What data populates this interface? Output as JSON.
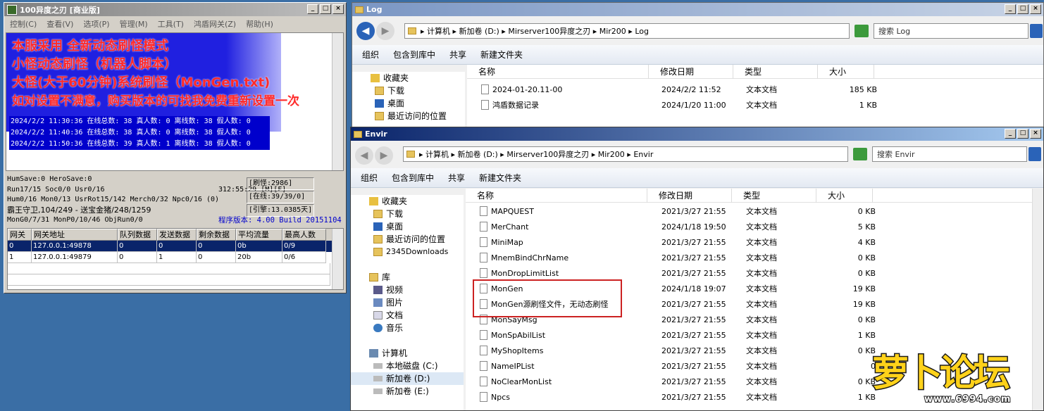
{
  "left_window": {
    "title": "100异度之刃 [商业版]",
    "menu": [
      "控制(C)",
      "查看(V)",
      "选项(P)",
      "管理(M)",
      "工具(T)",
      "鸿盾网关(Z)",
      "帮助(H)"
    ],
    "overlay_lines": [
      "本服采用 全新动态刷怪模式",
      "小怪动态刷怪（机器人脚本）",
      "大怪(大于60分钟)系统刷怪（MonGen.txt)",
      "如对设置不满意，购买版本的可找我免费重新设置一次"
    ],
    "log_lines": [
      "2024/2/2 11:30:36 在线总数: 38 真人数: 0 离线数: 38 假人数: 0",
      "2024/2/2 11:40:36 在线总数: 38 真人数: 0 离线数: 38 假人数: 0",
      "2024/2/2 11:50:36 在线总数: 39 真人数: 1 离线数: 38 假人数: 0"
    ],
    "status": {
      "hum_save": "HumSave:0 HeroSave:0",
      "run": "Run17/15 Soc0/0 Usr0/16",
      "time": "312:55:29 [M][F]",
      "hum": "Hum0/16 Mon0/13 UsrRot15/142 Merch0/32 Npc0/16 (0)",
      "king": "霸王守卫,104/249 - 送宝金猪/248/1259",
      "mongen": "MonG0/7/31 MonP0/10/46 ObjRun0/0",
      "refresh": "[刷怪:2986]",
      "online": "[在线:39/39/0]",
      "engine": "[引擎:13.0385天]",
      "version": "程序版本: 4.00 Build 20151104"
    },
    "grid": {
      "headers": [
        "网关",
        "网关地址",
        "队列数据",
        "发送数据",
        "剩余数据",
        "平均流量",
        "最高人数"
      ],
      "rows": [
        [
          "0",
          "127.0.0.1:49878",
          "0",
          "0",
          "0",
          "0b",
          "0/9"
        ],
        [
          "1",
          "127.0.0.1:49879",
          "0",
          "1",
          "0",
          "20b",
          "0/6"
        ]
      ]
    }
  },
  "log_window": {
    "title": "Log",
    "path": [
      "计算机",
      "新加卷 (D:)",
      "Mirserver100异度之刃",
      "Mir200",
      "Log"
    ],
    "search_placeholder": "搜索 Log",
    "toolbar": [
      "组织",
      "包含到库中",
      "共享",
      "新建文件夹"
    ],
    "nav": [
      "收藏夹",
      "下载",
      "桌面",
      "最近访问的位置"
    ],
    "columns": [
      "名称",
      "修改日期",
      "类型",
      "大小"
    ],
    "files": [
      {
        "name": "2024-01-20.11-00",
        "date": "2024/2/2 11:52",
        "type": "文本文档",
        "size": "185 KB"
      },
      {
        "name": "鸿盾数据记录",
        "date": "2024/1/20 11:00",
        "type": "文本文档",
        "size": "1 KB"
      }
    ]
  },
  "envir_window": {
    "title": "Envir",
    "path": [
      "计算机",
      "新加卷 (D:)",
      "Mirserver100异度之刃",
      "Mir200",
      "Envir"
    ],
    "search_placeholder": "搜索 Envir",
    "toolbar": [
      "组织",
      "包含到库中",
      "共享",
      "新建文件夹"
    ],
    "nav": {
      "favorites": [
        "收藏夹",
        "下载",
        "桌面",
        "最近访问的位置",
        "2345Downloads"
      ],
      "library": [
        "库",
        "视频",
        "图片",
        "文档",
        "音乐"
      ],
      "computer": [
        "计算机",
        "本地磁盘 (C:)",
        "新加卷 (D:)",
        "新加卷 (E:)"
      ]
    },
    "columns": [
      "名称",
      "修改日期",
      "类型",
      "大小"
    ],
    "files": [
      {
        "name": "MAPQUEST",
        "date": "2021/3/27 21:55",
        "type": "文本文档",
        "size": "0 KB"
      },
      {
        "name": "MerChant",
        "date": "2024/1/18 19:50",
        "type": "文本文档",
        "size": "5 KB"
      },
      {
        "name": "MiniMap",
        "date": "2021/3/27 21:55",
        "type": "文本文档",
        "size": "4 KB"
      },
      {
        "name": "MnemBindChrName",
        "date": "2021/3/27 21:55",
        "type": "文本文档",
        "size": "0 KB"
      },
      {
        "name": "MonDropLimitList",
        "date": "2021/3/27 21:55",
        "type": "文本文档",
        "size": "0 KB"
      },
      {
        "name": "MonGen",
        "date": "2024/1/18 19:07",
        "type": "文本文档",
        "size": "19 KB"
      },
      {
        "name": "MonGen源刷怪文件，无动态刷怪",
        "date": "2021/3/27 21:55",
        "type": "文本文档",
        "size": "19 KB"
      },
      {
        "name": "MonSayMsg",
        "date": "2021/3/27 21:55",
        "type": "文本文档",
        "size": "0 KB"
      },
      {
        "name": "MonSpAbilList",
        "date": "2021/3/27 21:55",
        "type": "文本文档",
        "size": "1 KB"
      },
      {
        "name": "MyShopItems",
        "date": "2021/3/27 21:55",
        "type": "文本文档",
        "size": "0 KB"
      },
      {
        "name": "NameIPList",
        "date": "2021/3/27 21:55",
        "type": "文本文档",
        "size": "0"
      },
      {
        "name": "NoClearMonList",
        "date": "2021/3/27 21:55",
        "type": "文本文档",
        "size": "0 KB"
      },
      {
        "name": "Npcs",
        "date": "2021/3/27 21:55",
        "type": "文本文档",
        "size": "1 KB"
      }
    ]
  },
  "watermark": {
    "text": "萝卜论坛",
    "url": "www.6994.com"
  },
  "colors": {
    "overlay_text": "#ff2a2a",
    "log_highlight": "#0000cc",
    "red_box": "#cc2222",
    "desktop": "#3a6ea5"
  }
}
